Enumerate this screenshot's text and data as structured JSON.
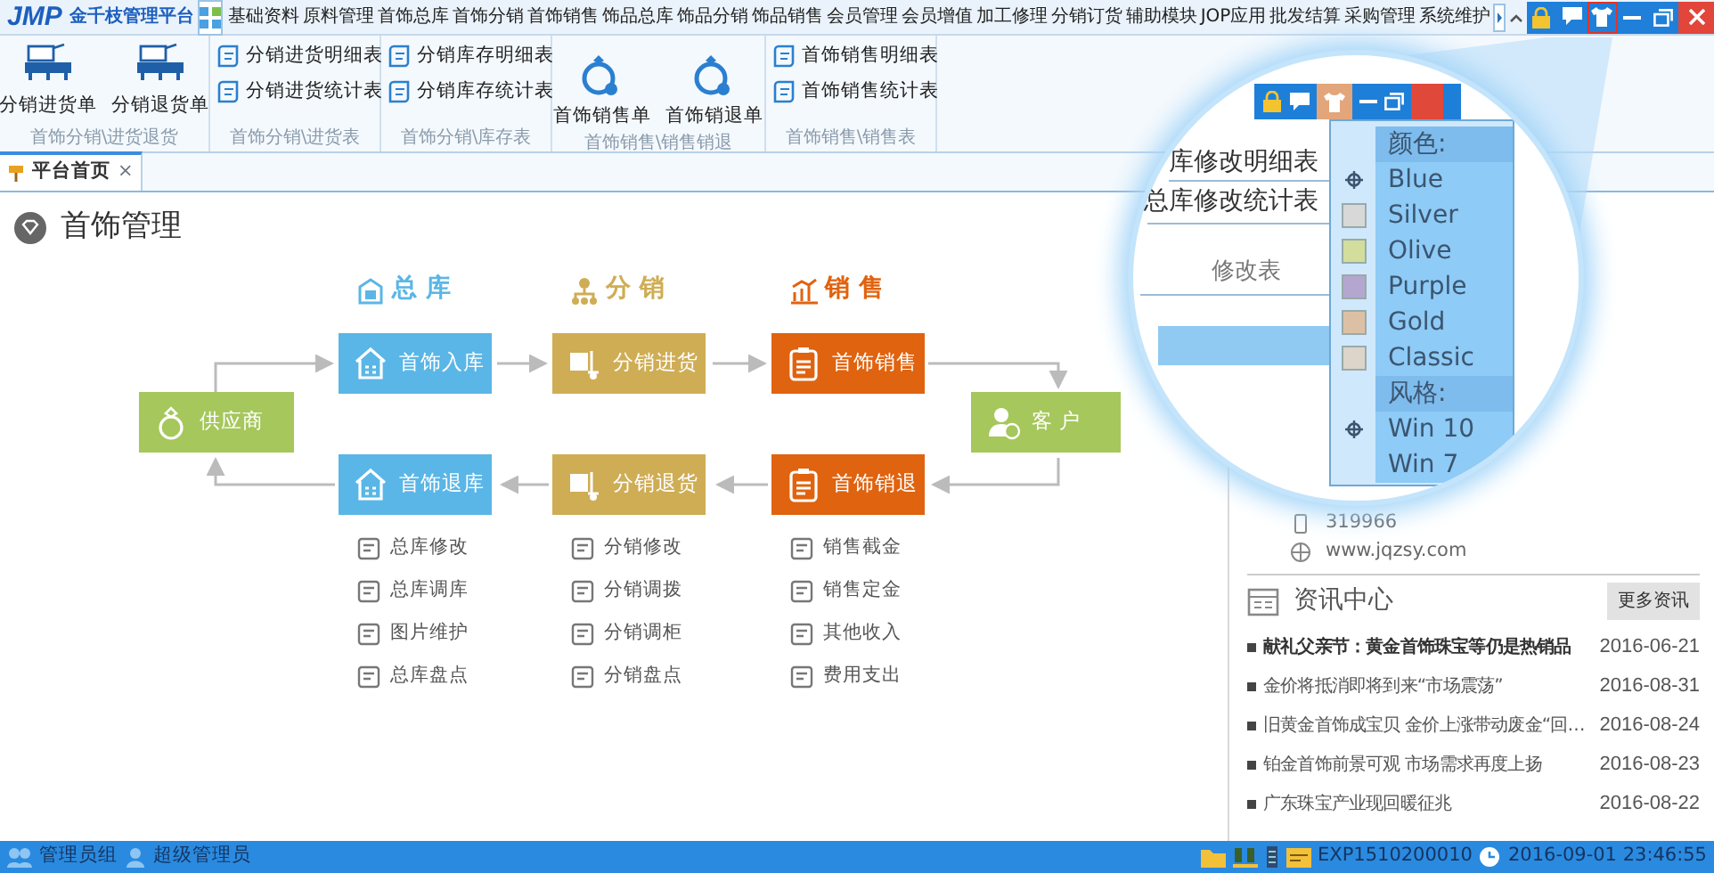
{
  "titlebar": {
    "logo": "JMP",
    "brand": "金千枝管理平台",
    "menu": [
      "基础资料",
      "原料管理",
      "首饰总库",
      "首饰分销",
      "首饰销售",
      "饰品总库",
      "饰品分销",
      "饰品销售",
      "会员管理",
      "会员增值",
      "加工修理",
      "分销订货",
      "辅助模块",
      "JOP应用",
      "批发结算",
      "采购管理",
      "系统维护"
    ],
    "window_buttons": [
      {
        "kind": "lock",
        "selected": false
      },
      {
        "kind": "chat",
        "selected": false
      },
      {
        "kind": "skin",
        "selected": true
      },
      {
        "kind": "minimize",
        "selected": false
      },
      {
        "kind": "restore",
        "selected": false
      },
      {
        "kind": "close",
        "selected": false
      }
    ]
  },
  "ribbon": [
    {
      "label": "首饰分销\\进货退货",
      "items": [
        {
          "kind": "large",
          "label": "分销进货单"
        },
        {
          "kind": "large",
          "label": "分销退货单"
        }
      ]
    },
    {
      "label": "首饰分销\\进货表",
      "items": [
        {
          "kind": "small",
          "label": "分销进货明细表"
        },
        {
          "kind": "small",
          "label": "分销进货统计表"
        }
      ]
    },
    {
      "label": "首饰分销\\库存表",
      "items": [
        {
          "kind": "small",
          "label": "分销库存明细表"
        },
        {
          "kind": "small",
          "label": "分销库存统计表"
        }
      ]
    },
    {
      "label": "首饰销售\\销售销退",
      "items": [
        {
          "kind": "large",
          "label": "首饰销售单"
        },
        {
          "kind": "large",
          "label": "首饰销退单"
        }
      ]
    },
    {
      "label": "首饰销售\\销售表",
      "items": [
        {
          "kind": "small",
          "label": "首饰销售明细表"
        },
        {
          "kind": "small",
          "label": "首饰销售统计表"
        }
      ]
    }
  ],
  "tabs": [
    {
      "label": "平台首页",
      "selected": true,
      "close": "×"
    }
  ],
  "page_title": "首饰管理",
  "diagram": {
    "supplier": "供应商",
    "customer": "客 户",
    "columns": [
      {
        "title": "总 库",
        "color": "#5ab6e6",
        "inbound": "首饰入库",
        "outbound": "首饰退库",
        "links": [
          "总库修改",
          "总库调库",
          "图片维护",
          "总库盘点"
        ]
      },
      {
        "title": "分 销",
        "color": "#cfad55",
        "inbound": "分销进货",
        "outbound": "分销退货",
        "links": [
          "分销修改",
          "分销调拨",
          "分销调柜",
          "分销盘点"
        ]
      },
      {
        "title": "销 售",
        "color": "#e0630f",
        "inbound": "首饰销售",
        "outbound": "首饰销退",
        "links": [
          "销售截金",
          "销售定金",
          "其他收入",
          "费用支出"
        ]
      }
    ]
  },
  "contact": [
    "319966",
    "www.jqzsy.com"
  ],
  "news": {
    "title": "资讯中心",
    "more": "更多资讯",
    "items": [
      {
        "title": "献礼父亲节：黄金首饰珠宝等仍是热销品",
        "date": "2016-06-21",
        "bold": true
      },
      {
        "title": "金价将抵消即将到来“市场震荡”",
        "date": "2016-08-31",
        "bold": false
      },
      {
        "title": "旧黄金首饰成宝贝 金价上涨带动废金“回…",
        "date": "2016-08-24",
        "bold": false
      },
      {
        "title": "铂金首饰前景可观 市场需求再度上扬",
        "date": "2016-08-23",
        "bold": false
      },
      {
        "title": "广东珠宝产业现回暖征兆",
        "date": "2016-08-22",
        "bold": false
      }
    ]
  },
  "magnifier": {
    "lines": [
      "库修改明细表",
      "总库修改统计表"
    ],
    "group_label": "修改表",
    "menu": [
      {
        "kind": "header",
        "label": "颜色:"
      },
      {
        "kind": "option",
        "label": "Blue",
        "selected": true
      },
      {
        "kind": "option",
        "label": "Silver",
        "selected": false,
        "color": "#d8d8d8"
      },
      {
        "kind": "option",
        "label": "Olive",
        "selected": false,
        "color": "#d3dd9c"
      },
      {
        "kind": "option",
        "label": "Purple",
        "selected": false,
        "color": "#b3a7cf"
      },
      {
        "kind": "option",
        "label": "Gold",
        "selected": false,
        "color": "#dcc0a6"
      },
      {
        "kind": "option",
        "label": "Classic",
        "selected": false,
        "color": "#ddd4ca"
      },
      {
        "kind": "header",
        "label": "风格:"
      },
      {
        "kind": "option",
        "label": "Win 10",
        "selected": true
      },
      {
        "kind": "option",
        "label": "Win 7",
        "selected": false
      }
    ]
  },
  "status_bar": {
    "group": "管理员组",
    "user": "超级管理员",
    "code": "EXP1510200010",
    "time": "2016-09-01 23:46:55"
  }
}
